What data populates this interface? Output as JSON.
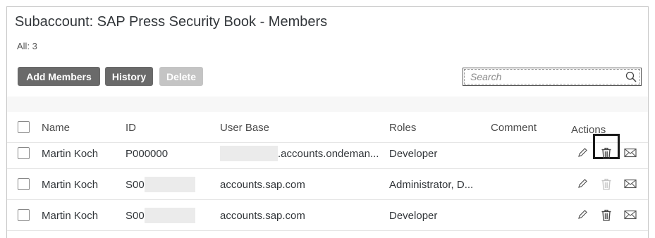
{
  "header": {
    "title": "Subaccount: SAP Press Security Book - Members",
    "count": "All: 3"
  },
  "toolbar": {
    "add_label": "Add Members",
    "history_label": "History",
    "delete_label": "Delete",
    "search_placeholder": "Search",
    "search_icon": "search-icon"
  },
  "table": {
    "columns": [
      "Name",
      "ID",
      "User Base",
      "Roles",
      "Comment",
      "Actions"
    ],
    "rows": [
      {
        "name": "Martin Koch",
        "id": "P000000",
        "user_base": ".accounts.ondeman...",
        "roles": "Developer",
        "comment": ""
      },
      {
        "name": "Martin Koch",
        "id": "S00",
        "user_base": "accounts.sap.com",
        "roles": "Administrator, D...",
        "comment": ""
      },
      {
        "name": "Martin Koch",
        "id": "S00",
        "user_base": "accounts.sap.com",
        "roles": "Developer",
        "comment": ""
      }
    ],
    "action_icons": [
      "pencil-icon",
      "trash-icon",
      "mail-icon"
    ]
  },
  "colors": {
    "button_primary": "#6a6a6a",
    "button_disabled": "#c4c4c4",
    "highlight_border": "#1a1a1a"
  }
}
